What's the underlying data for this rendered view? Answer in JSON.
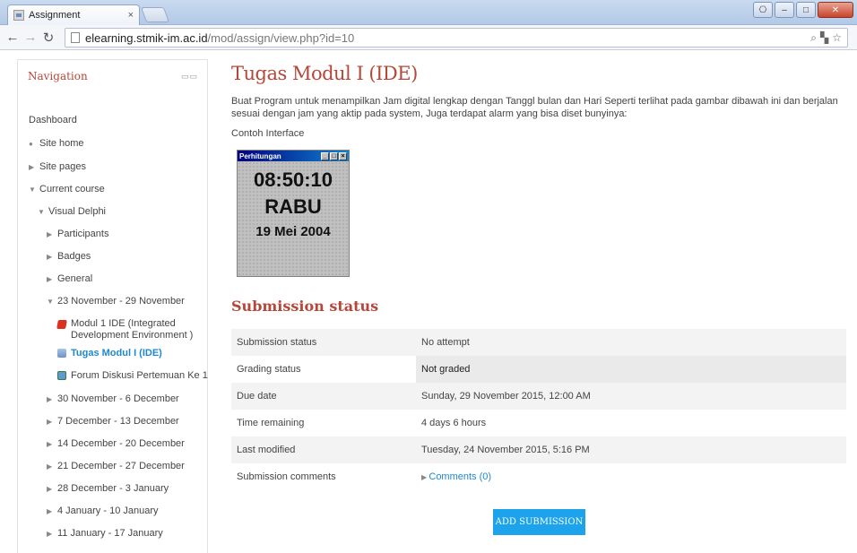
{
  "browser": {
    "tab_title": "Assignment",
    "tab_close": "×",
    "url_host": "elearning.stmik-im.ac.id",
    "url_path": "/mod/assign/view.php?id=10"
  },
  "sidebar": {
    "title": "Navigation",
    "dock": "▭▭",
    "items": [
      {
        "label": "Dashboard",
        "marker": ""
      },
      {
        "label": "Site home",
        "marker": "●"
      },
      {
        "label": "Site pages",
        "marker": "▶"
      },
      {
        "label": "Current course",
        "marker": "▼"
      },
      {
        "label": "Visual Delphi",
        "marker": "▼"
      },
      {
        "label": "Participants",
        "marker": "▶"
      },
      {
        "label": "Badges",
        "marker": "▶"
      },
      {
        "label": "General",
        "marker": "▶"
      },
      {
        "label": "23 November - 29 November",
        "marker": "▼"
      },
      {
        "label": "Modul 1 IDE (Integrated Development Environment )",
        "icon": "pdf-icon"
      },
      {
        "label": "Tugas Modul I (IDE)",
        "icon": "assignment-icon"
      },
      {
        "label": "Forum Diskusi Pertemuan Ke 1",
        "icon": "forum-icon"
      },
      {
        "label": "30 November - 6 December",
        "marker": "▶"
      },
      {
        "label": "7 December - 13 December",
        "marker": "▶"
      },
      {
        "label": "14 December - 20 December",
        "marker": "▶"
      },
      {
        "label": "21 December - 27 December",
        "marker": "▶"
      },
      {
        "label": "28 December - 3 January",
        "marker": "▶"
      },
      {
        "label": "4 January - 10 January",
        "marker": "▶"
      },
      {
        "label": "11 January - 17 January",
        "marker": "▶"
      }
    ]
  },
  "main": {
    "title": "Tugas Modul I (IDE)",
    "description": "Buat Program untuk menampilkan Jam digital lengkap dengan Tanggl bulan dan Hari Seperti terlihat pada gambar dibawah ini dan berjalan sesuai dengan jam yang aktip pada system, Juga terdapat alarm yang bisa diset bunyinya:",
    "example_label": "Contoh Interface",
    "example_window": {
      "title": "Perhitungan",
      "time": "08:50:10",
      "day": "RABU",
      "date": "19 Mei 2004"
    },
    "submission_heading": "Submission status",
    "rows": [
      {
        "label": "Submission status",
        "value": "No attempt"
      },
      {
        "label": "Grading status",
        "value": "Not graded"
      },
      {
        "label": "Due date",
        "value": "Sunday, 29 November 2015, 12:00 AM"
      },
      {
        "label": "Time remaining",
        "value": "4 days 6 hours"
      },
      {
        "label": "Last modified",
        "value": "Tuesday, 24 November 2015, 5:16 PM"
      },
      {
        "label": "Submission comments",
        "value": "Comments (0)"
      }
    ],
    "add_button": "ADD SUBMISSION"
  }
}
